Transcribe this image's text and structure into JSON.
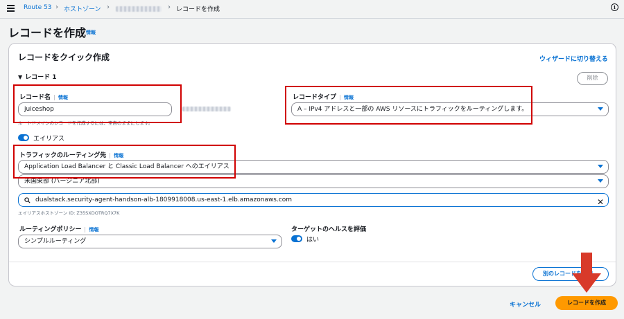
{
  "breadcrumb": {
    "items": [
      "Route 53",
      "ホストゾーン",
      "",
      "レコードを作成"
    ]
  },
  "page": {
    "title": "レコードを作成",
    "title_info": "情報"
  },
  "card": {
    "title": "レコードをクイック作成",
    "switch_wizard": "ウィザードに切り替える",
    "record_header": "レコード 1",
    "delete_label": "削除"
  },
  "record_name": {
    "label": "レコード名",
    "info": "情報",
    "value": "juiceshop",
    "hint": "ルートドメインのレコードを作成するには、空白のままにします。"
  },
  "record_type": {
    "label": "レコードタイプ",
    "info": "情報",
    "value": "A – IPv4 アドレスと一部の AWS リソースにトラフィックをルーティングします。"
  },
  "alias": {
    "label": "エイリアス",
    "enabled": true
  },
  "route_traffic": {
    "label": "トラフィックのルーティング先",
    "info": "情報",
    "endpoint_value": "Application Load Balancer と Classic Load Balancer へのエイリアス",
    "region_value": "米国東部 (バージニア北部)",
    "lb_value": "dualstack.security-agent-handson-alb-1809918008.us-east-1.elb.amazonaws.com",
    "hosted_zone_hint": "エイリアスホストゾーン ID: Z35SXDOTRQ7X7K"
  },
  "routing_policy": {
    "label": "ルーティングポリシー",
    "info": "情報",
    "value": "シンプルルーティング"
  },
  "health": {
    "label": "ターゲットのヘルスを評価",
    "toggle_label": "はい",
    "enabled": true
  },
  "footer": {
    "add_record": "別のレコードを追加",
    "cancel": "キャンセル",
    "create": "レコードを作成"
  },
  "colors": {
    "accent": "#0972d3",
    "primary_button": "#ff9900",
    "annotation_red": "#d00000"
  }
}
